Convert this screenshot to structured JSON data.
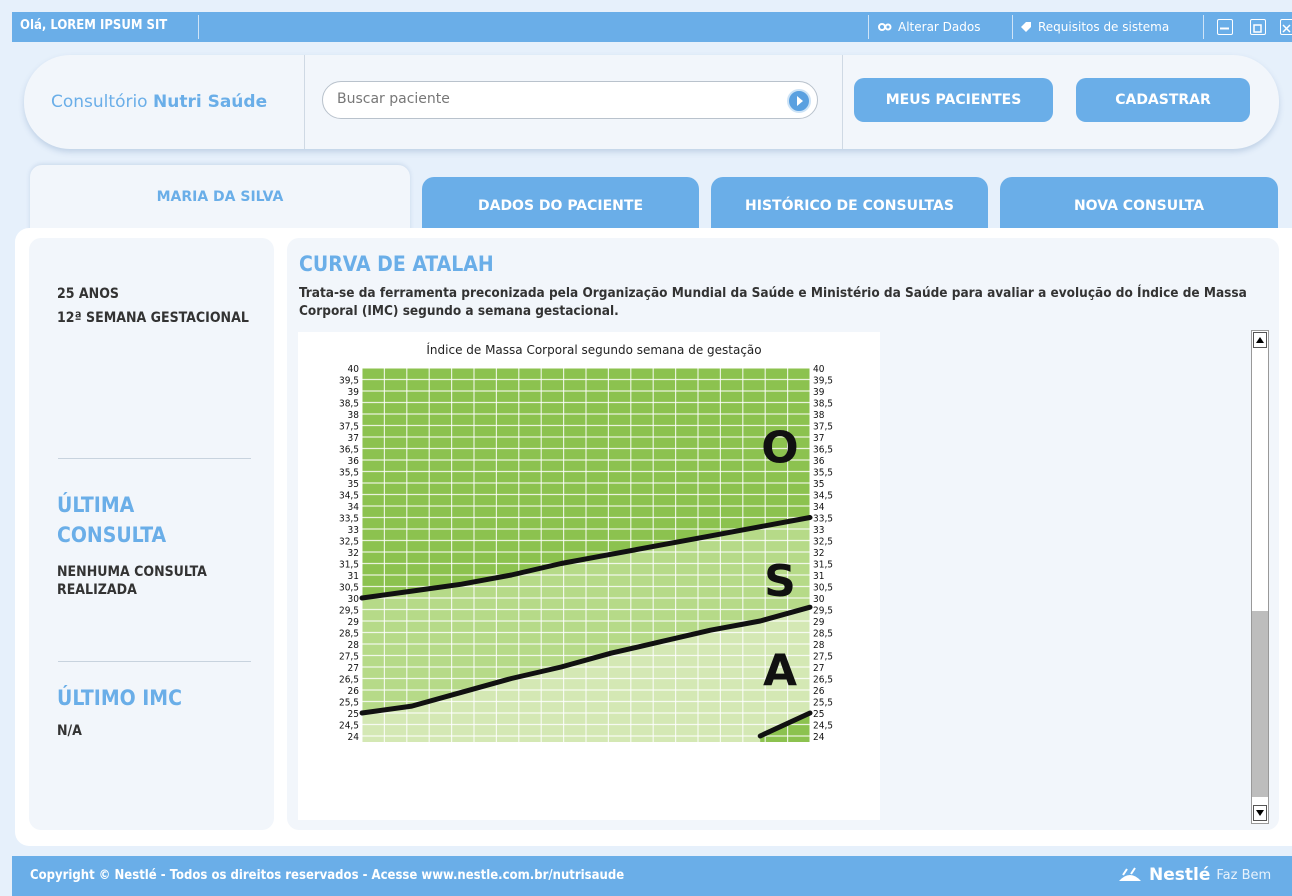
{
  "topbar": {
    "greeting": "Olá, LOREM IPSUM SIT",
    "alterar_dados": "Alterar Dados",
    "requisitos": "Requisitos de sistema"
  },
  "header": {
    "brand_regular": "Consultório",
    "brand_bold": "Nutri Saúde",
    "search_placeholder": "Buscar paciente",
    "meus_pacientes": "MEUS PACIENTES",
    "cadastrar": "CADASTRAR"
  },
  "tabs": {
    "patient_name": "MARIA DA SILVA",
    "dados": "DADOS DO PACIENTE",
    "historico": "HISTÓRICO DE CONSULTAS",
    "nova": "NOVA CONSULTA"
  },
  "patient": {
    "age": "25 ANOS",
    "week": "12ª SEMANA GESTACIONAL",
    "last_consult_heading": "ÚLTIMA CONSULTA",
    "last_consult_value": "NENHUMA CONSULTA REALIZADA",
    "last_imc_heading": "ÚLTIMO IMC",
    "last_imc_value": "N/A"
  },
  "content": {
    "title": "CURVA DE ATALAH",
    "description": "Trata-se da ferramenta preconizada pela Organização Mundial da Saúde e Ministério da Saúde para avaliar a evolução do Índice de Massa Corporal (IMC) segundo a semana gestacional."
  },
  "chart_data": {
    "type": "line",
    "title": "Índice de Massa Corporal segundo semana de gestação",
    "ylim": [
      24,
      40
    ],
    "y_ticks": [
      "40",
      "39,5",
      "39",
      "38,5",
      "38",
      "37,5",
      "37",
      "36,5",
      "36",
      "35,5",
      "35",
      "34,5",
      "34",
      "33,5",
      "33",
      "32,5",
      "32",
      "31,5",
      "31",
      "30,5",
      "30",
      "29,5",
      "29",
      "28,5",
      "28",
      "27,5",
      "27",
      "26,5",
      "26",
      "25,5",
      "25",
      "24,5",
      "24"
    ],
    "zone_labels": [
      {
        "text": "O",
        "imc": 36.5
      },
      {
        "text": "S",
        "imc": 30.7
      },
      {
        "text": "A",
        "imc": 26.8
      }
    ],
    "series": [
      {
        "values": [
          30.0,
          30.3,
          30.6,
          31.0,
          31.5,
          31.9,
          32.3,
          32.7,
          33.1,
          33.5
        ]
      },
      {
        "values": [
          25.0,
          25.3,
          25.9,
          26.5,
          27.0,
          27.6,
          28.1,
          28.6,
          29.0,
          29.6
        ]
      },
      {
        "values": [
          null,
          null,
          null,
          null,
          null,
          null,
          null,
          null,
          24.0,
          25.0
        ]
      }
    ],
    "colors": {
      "grid_dark": "#8cc24f",
      "grid_light": "#d4e8b4",
      "line": "#111111"
    }
  },
  "footer": {
    "copyright": "Copyright © Nestlé - Todos os direitos reservados -",
    "site": "Acesse www.nestle.com.br/nutrisaude",
    "brand": "Nestlé",
    "tagline": "Faz Bem"
  }
}
